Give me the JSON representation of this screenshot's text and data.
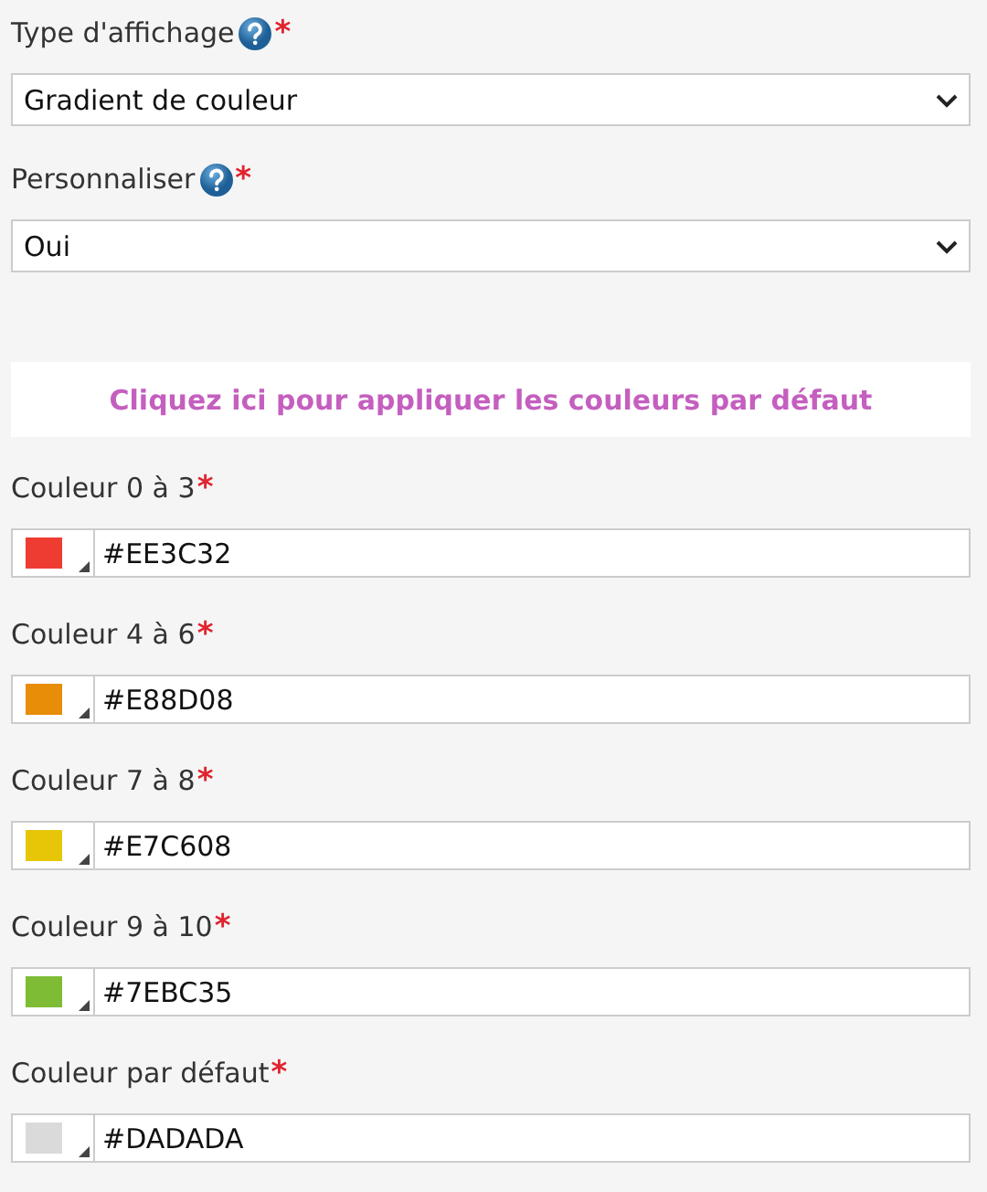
{
  "selects": [
    {
      "label": "Type d'affichage",
      "help": true,
      "required_mark": "*",
      "value": "Gradient de couleur"
    },
    {
      "label": "Personnaliser",
      "help": true,
      "required_mark": "*",
      "value": "Oui"
    }
  ],
  "default_button": "Cliquez ici pour appliquer les couleurs par défaut",
  "colors": [
    {
      "label": "Couleur 0 à 3",
      "required_mark": "*",
      "value": "#EE3C32",
      "color": "#ee3c32"
    },
    {
      "label": "Couleur 4 à 6",
      "required_mark": "*",
      "value": "#E88D08",
      "color": "#e88d08"
    },
    {
      "label": "Couleur 7 à 8",
      "required_mark": "*",
      "value": "#E7C608",
      "color": "#e7c608"
    },
    {
      "label": "Couleur 9 à 10",
      "required_mark": "*",
      "value": "#7EBC35",
      "color": "#7ebc35"
    },
    {
      "label": "Couleur par défaut",
      "required_mark": "*",
      "value": "#DADADA",
      "color": "#dadada"
    }
  ]
}
